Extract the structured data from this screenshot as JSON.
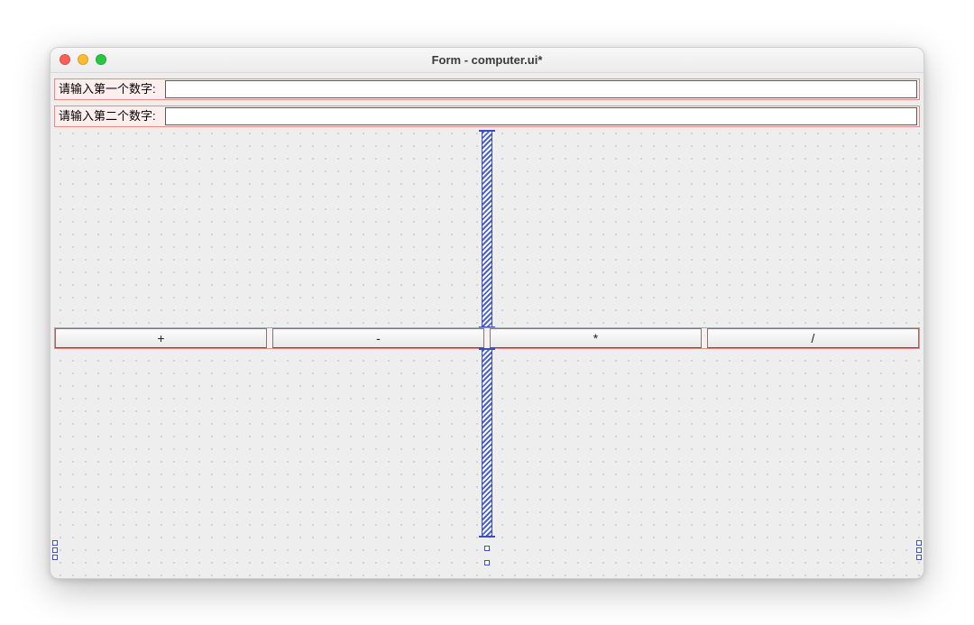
{
  "window": {
    "title": "Form - computer.ui*"
  },
  "inputs": {
    "first": {
      "label": "请输入第一个数字:",
      "value": ""
    },
    "second": {
      "label": "请输入第二个数字:",
      "value": ""
    }
  },
  "buttons": {
    "add": "+",
    "sub": "-",
    "mul": "*",
    "div": "/"
  }
}
